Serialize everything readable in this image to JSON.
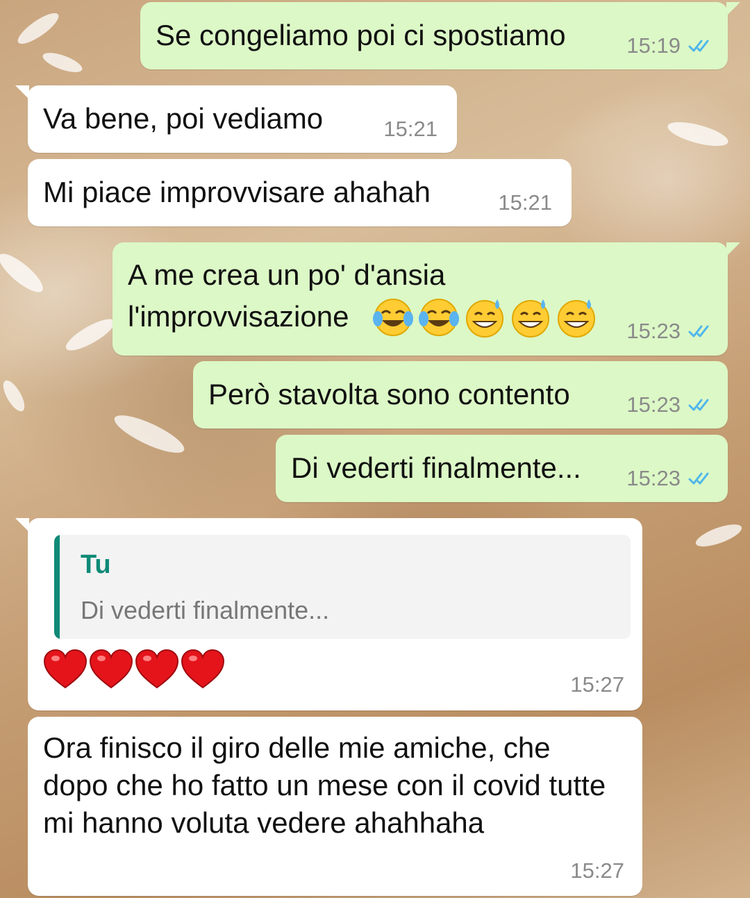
{
  "chat": {
    "messages": [
      {
        "direction": "out",
        "text": "Se congeliamo poi ci spostiamo",
        "time": "15:19",
        "status": "read"
      },
      {
        "direction": "in",
        "text": "Va bene, poi vediamo",
        "time": "15:21"
      },
      {
        "direction": "in",
        "text": "Mi piace improvvisare ahahah",
        "time": "15:21"
      },
      {
        "direction": "out",
        "text_line1": "A me crea un po' d'ansia",
        "text_line2": "l'improvvisazione",
        "emojis": [
          "face-with-tears-of-joy",
          "face-with-tears-of-joy",
          "grinning-face-with-sweat",
          "grinning-face-with-sweat",
          "grinning-face-with-sweat"
        ],
        "time": "15:23",
        "status": "read"
      },
      {
        "direction": "out",
        "text": "Però stavolta sono contento",
        "time": "15:23",
        "status": "read"
      },
      {
        "direction": "out",
        "text": "Di vederti finalmente...",
        "time": "15:23",
        "status": "read"
      },
      {
        "direction": "in",
        "reply_to": {
          "author": "Tu",
          "text": "Di vederti finalmente..."
        },
        "emojis": [
          "red-heart",
          "red-heart",
          "red-heart",
          "red-heart"
        ],
        "time": "15:27"
      },
      {
        "direction": "in",
        "text": "Ora finisco il giro delle mie amiche, che dopo che ho fatto un mese con il covid tutte mi hanno voluta vedere ahahhaha",
        "time": "15:27"
      }
    ]
  },
  "colors": {
    "outgoing_bubble": "#dcf8c6",
    "incoming_bubble": "#ffffff",
    "read_ticks": "#4fb6ec",
    "reply_accent": "#0f8a77",
    "timestamp": "#8a8a8a"
  }
}
